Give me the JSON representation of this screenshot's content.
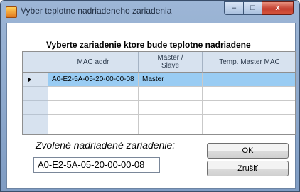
{
  "window": {
    "title": "Vyber teplotne nadriadeneho zariadenia"
  },
  "caption": {
    "minimize_glyph": "–",
    "maximize_glyph": "□",
    "close_glyph": "x"
  },
  "heading": "Vyberte zariadenie ktore bude teplotne nadriadene",
  "grid": {
    "columns": [
      "MAC addr",
      "Master / Slave",
      "Temp. Master MAC"
    ],
    "rows": [
      {
        "mac": "A0-E2-5A-05-20-00-00-08",
        "role": "Master",
        "temp_master_mac": "",
        "selected": true
      },
      {
        "mac": "",
        "role": "",
        "temp_master_mac": ""
      },
      {
        "mac": "",
        "role": "",
        "temp_master_mac": ""
      },
      {
        "mac": "",
        "role": "",
        "temp_master_mac": ""
      },
      {
        "mac": "",
        "role": "",
        "temp_master_mac": ""
      }
    ],
    "selection_color": "#99ccf3"
  },
  "selected_device": {
    "label": "Zvolené nadriadené zariadenie:",
    "value": "A0-E2-5A-05-20-00-00-08"
  },
  "buttons": {
    "ok": "OK",
    "cancel": "Zrušiť"
  }
}
